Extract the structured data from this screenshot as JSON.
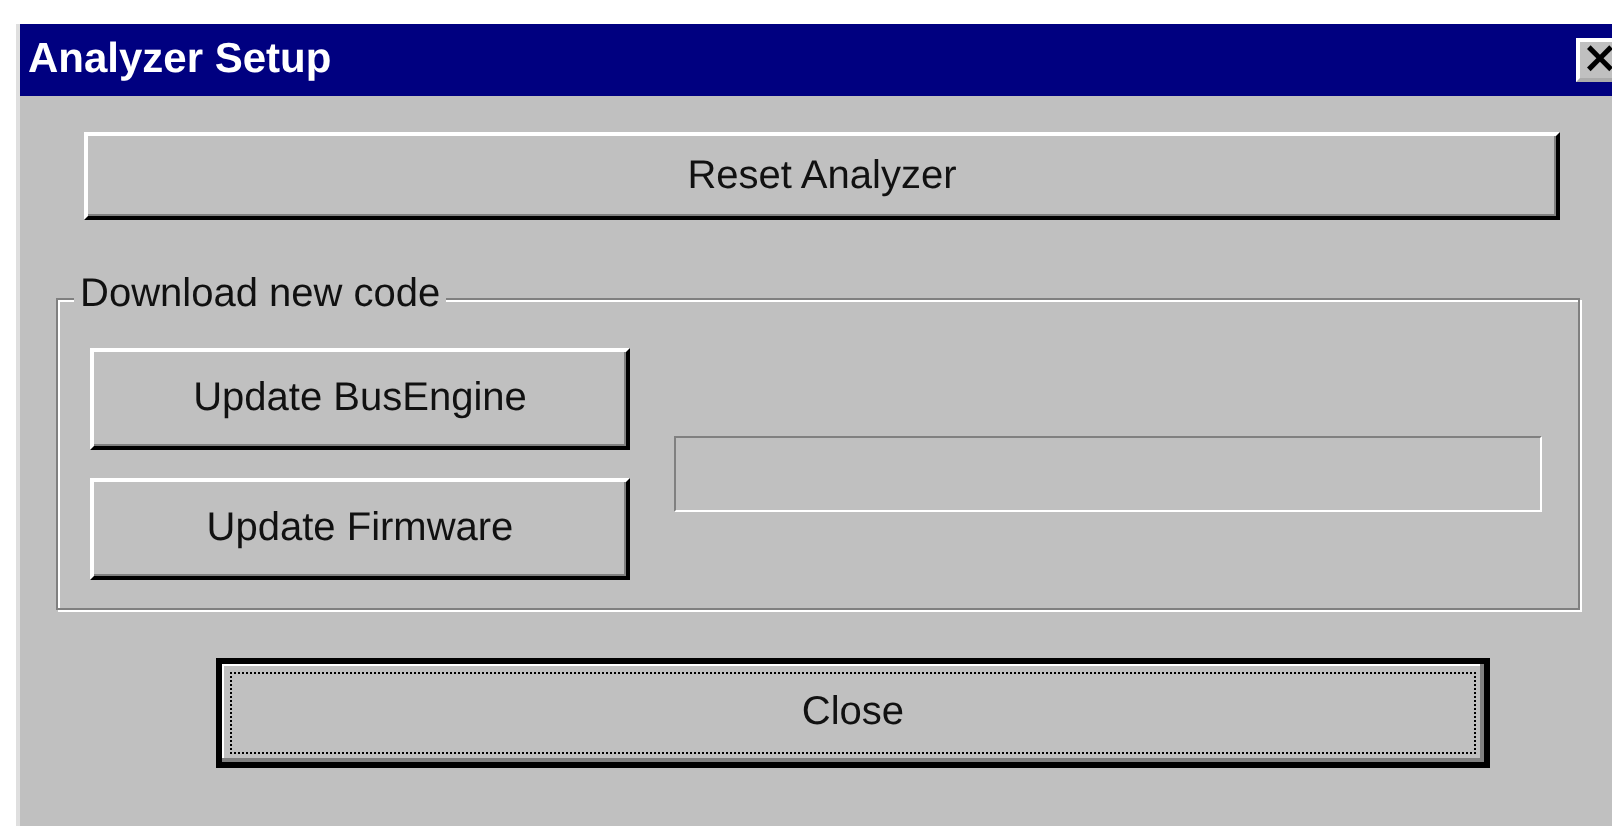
{
  "window": {
    "title": "Analyzer Setup",
    "close_glyph": "×"
  },
  "reset_button": {
    "label": "Reset Analyzer",
    "focused": false
  },
  "group": {
    "legend": "Download new code",
    "buttons": [
      {
        "label": "Update BusEngine",
        "focused": false
      },
      {
        "label": "Update Firmware",
        "focused": false
      }
    ],
    "progress": {
      "level": 0
    }
  },
  "close_button": {
    "label": "Close",
    "focused": true
  }
}
